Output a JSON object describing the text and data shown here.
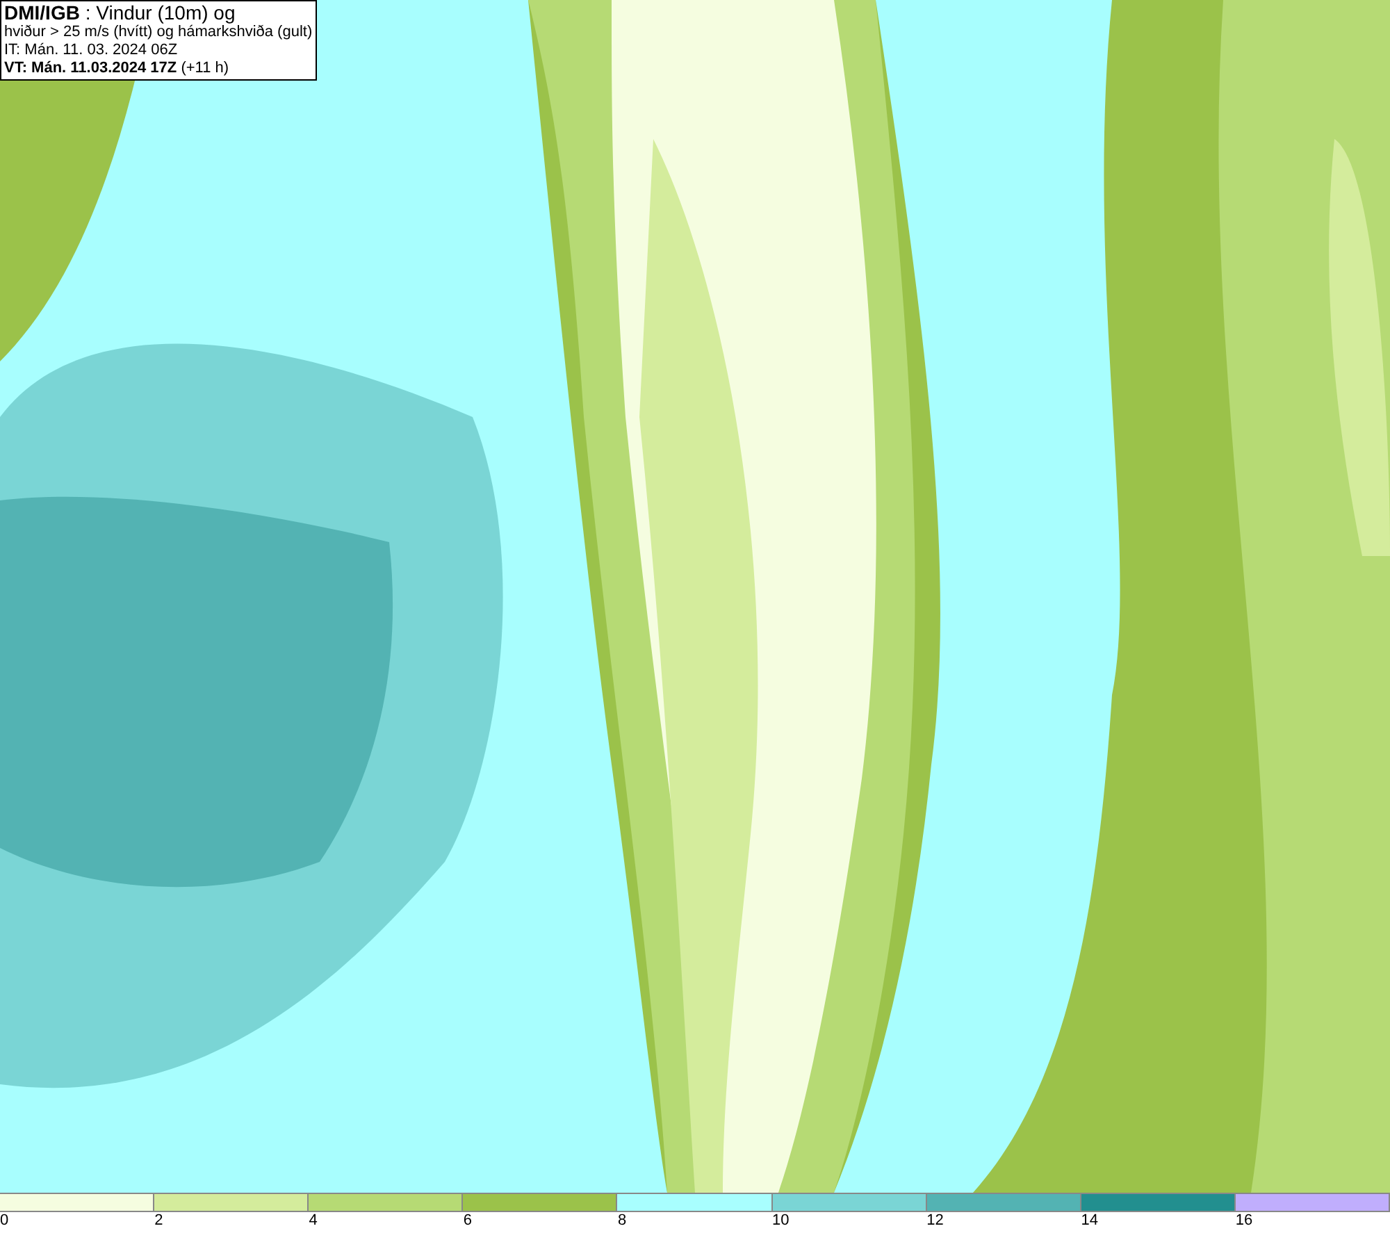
{
  "info_box": {
    "lines": [
      "**DMI/IGB** : Vindur (10m) og",
      "hviður > 25 m/s (hvítt) og hámarkshviða (gult)",
      "IT: Mán. 11. 03. 2024 06Z",
      "**VT: Mán. 11.03.2024 17Z** (+11 h)"
    ]
  },
  "legend": {
    "bins": [
      {
        "color": "#f5fde0"
      },
      {
        "color": "#d4ec9c"
      },
      {
        "color": "#b6da74"
      },
      {
        "color": "#9bc24a"
      },
      {
        "color": "#a8fefe"
      },
      {
        "color": "#7ad5d5"
      },
      {
        "color": "#53b3b3"
      },
      {
        "color": "#228f8f"
      },
      {
        "color": "#c0aefd"
      }
    ],
    "ticks": [
      "0",
      "2",
      "4",
      "6",
      "8",
      "10",
      "12",
      "14",
      "16"
    ]
  }
}
